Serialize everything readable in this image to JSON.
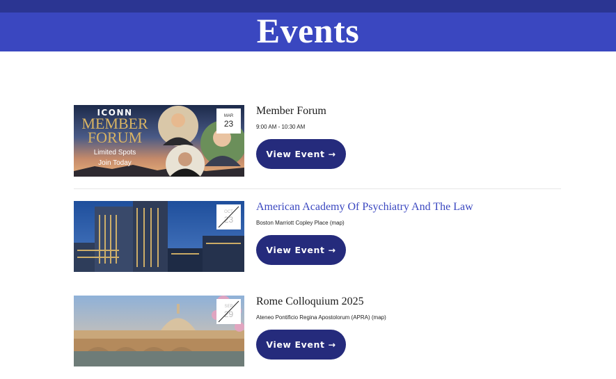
{
  "header": {
    "title": "Events"
  },
  "events": [
    {
      "title": "Member Forum",
      "subtitle": "9:00 AM - 10:30 AM",
      "button": "View Event →",
      "badge": {
        "month": "MAR",
        "day": "23"
      },
      "thumb_text": {
        "line1": "ICONN",
        "line2": "MEMBER",
        "line3": "FORUM",
        "line4": "Limited Spots",
        "line5": "Join Today"
      }
    },
    {
      "title": "American Academy Of Psychiatry And The Law",
      "subtitle": "Boston Marriott Copley Place (map)",
      "button": "View Event →",
      "badge": {
        "month": "OCT",
        "day": "23"
      }
    },
    {
      "title": "Rome Colloquium 2025",
      "subtitle": "Ateneo Pontificio Regina Apostolorum (APRA) (map)",
      "button": "View Event →",
      "badge": {
        "month": "SEP",
        "day": "29"
      }
    }
  ],
  "colors": {
    "topbar": "#2b3592",
    "banner": "#3a47c0",
    "button": "#252b7c",
    "link": "#3a47c0"
  }
}
